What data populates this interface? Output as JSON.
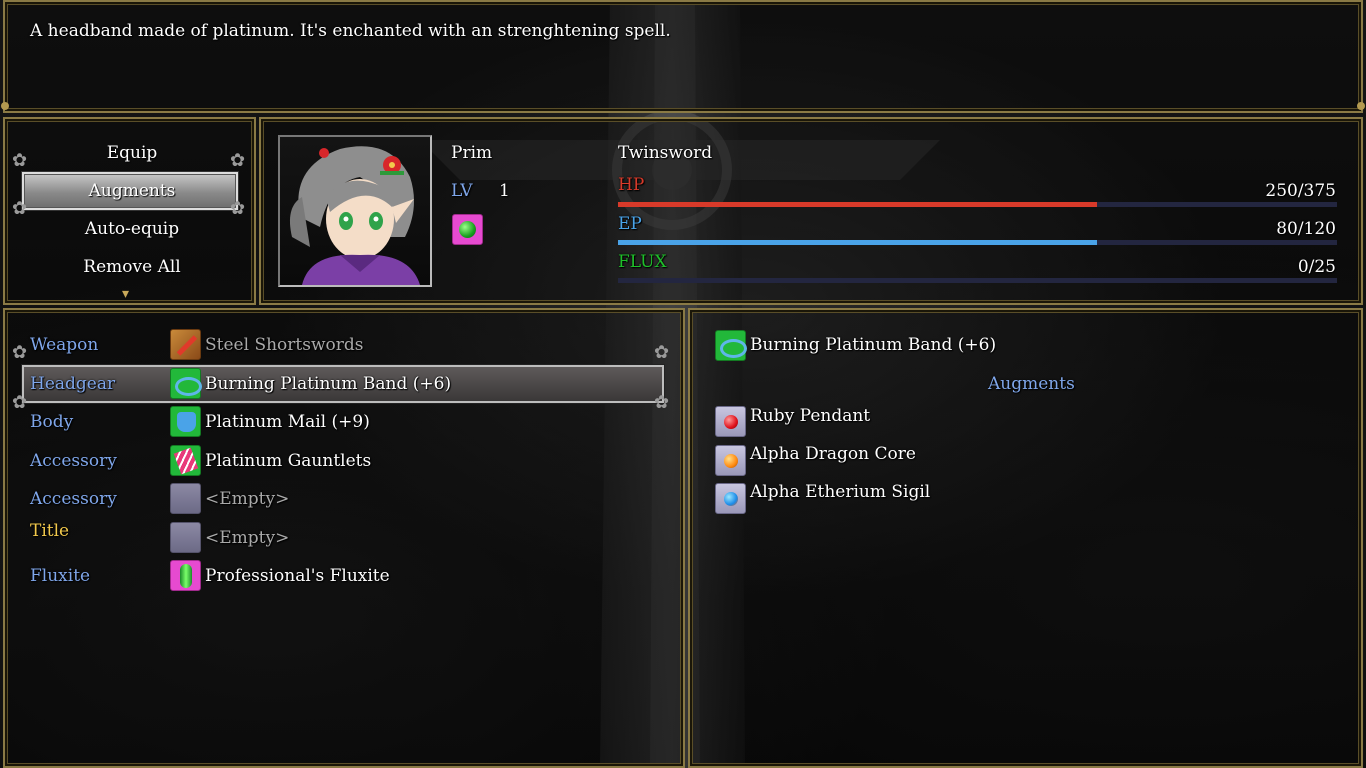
{
  "description": "A headband made of platinum. It's enchanted with an strenghtening spell.",
  "commands": {
    "items": [
      "Equip",
      "Augments",
      "Auto-equip",
      "Remove All"
    ],
    "selected_index": 1
  },
  "character": {
    "name": "Prim",
    "lv_label": "LV",
    "level": "1",
    "class_name": "Twinsword",
    "stats": {
      "hp": {
        "label": "HP",
        "value": "250/375",
        "ratio": 0.6667,
        "color": "#d83a2a"
      },
      "ep": {
        "label": "EP",
        "value": "80/120",
        "ratio": 0.6667,
        "color": "#4aa3e8"
      },
      "flux": {
        "label": "FLUX",
        "value": "0/25",
        "ratio": 0,
        "color": "#1fbf2a"
      }
    }
  },
  "equipment": {
    "selected_index": 1,
    "slots": [
      {
        "slot": "Weapon",
        "item": "Steel Shortswords",
        "icon": "sword-icon",
        "dim": true
      },
      {
        "slot": "Headgear",
        "item": "Burning Platinum Band (+6)",
        "icon": "headband-icon",
        "dim": false
      },
      {
        "slot": "Body",
        "item": "Platinum Mail (+9)",
        "icon": "armor-icon",
        "dim": false
      },
      {
        "slot": "Accessory",
        "item": "Platinum Gauntlets",
        "icon": "gauntlet-icon",
        "dim": false
      },
      {
        "slot": "Accessory",
        "item": "<Empty>",
        "icon": "empty-slot-icon",
        "dim": true
      },
      {
        "slot": "Title",
        "item": "<Empty>",
        "icon": "empty-slot-icon",
        "dim": true
      },
      {
        "slot": "Fluxite",
        "item": "Professional's Fluxite",
        "icon": "fluxite-icon",
        "dim": false
      }
    ]
  },
  "augments_panel": {
    "item_name": "Burning Platinum Band (+6)",
    "heading": "Augments",
    "augments": [
      {
        "name": "Ruby Pendant",
        "icon": "ruby-gem-icon"
      },
      {
        "name": "Alpha Dragon Core",
        "icon": "orange-gem-icon"
      },
      {
        "name": "Alpha Etherium Sigil",
        "icon": "blue-gem-icon"
      }
    ]
  },
  "colors": {
    "slot_label": "#7fa6ea",
    "title_label": "#f2c94c",
    "panel_border": "#8a7a45"
  }
}
